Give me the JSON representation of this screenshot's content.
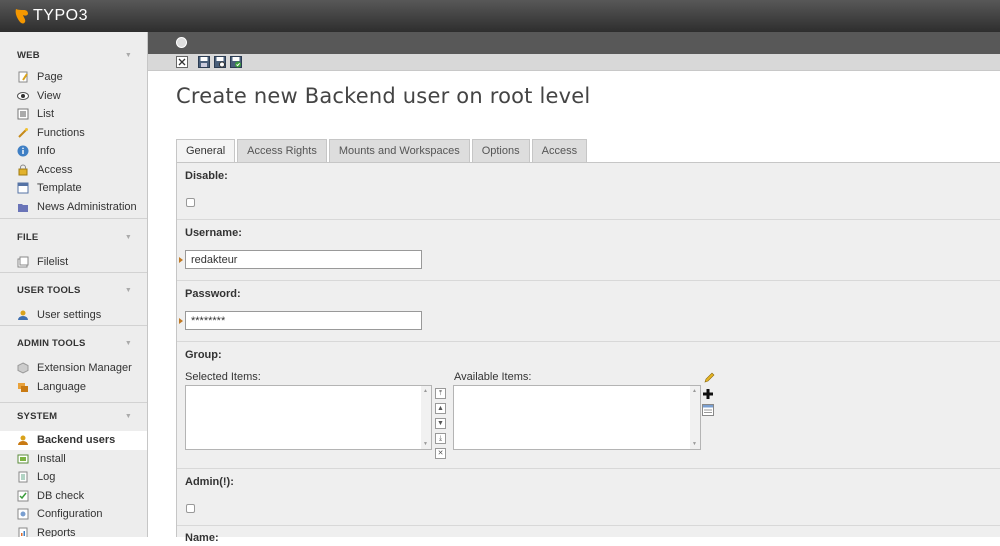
{
  "app": {
    "logo_text": "TYPO3",
    "brand_color": "#f49700"
  },
  "sidebar": {
    "groups": [
      {
        "title": "WEB",
        "items": [
          {
            "label": "Page",
            "icon": "page-icon"
          },
          {
            "label": "View",
            "icon": "eye-icon"
          },
          {
            "label": "List",
            "icon": "list-icon"
          },
          {
            "label": "Functions",
            "icon": "wand-icon"
          },
          {
            "label": "Info",
            "icon": "info-icon"
          },
          {
            "label": "Access",
            "icon": "lock-icon"
          },
          {
            "label": "Template",
            "icon": "template-icon"
          },
          {
            "label": "News Administration",
            "icon": "folder-icon"
          }
        ]
      },
      {
        "title": "FILE",
        "items": [
          {
            "label": "Filelist",
            "icon": "filelist-icon"
          }
        ]
      },
      {
        "title": "USER TOOLS",
        "items": [
          {
            "label": "User settings",
            "icon": "user-icon"
          }
        ]
      },
      {
        "title": "ADMIN TOOLS",
        "items": [
          {
            "label": "Extension Manager",
            "icon": "extension-icon"
          },
          {
            "label": "Language",
            "icon": "language-icon"
          }
        ]
      },
      {
        "title": "SYSTEM",
        "items": [
          {
            "label": "Backend users",
            "icon": "backend-user-icon"
          },
          {
            "label": "Install",
            "icon": "install-icon"
          },
          {
            "label": "Log",
            "icon": "log-icon"
          },
          {
            "label": "DB check",
            "icon": "db-check-icon"
          },
          {
            "label": "Configuration",
            "icon": "configuration-icon"
          },
          {
            "label": "Reports",
            "icon": "reports-icon"
          }
        ]
      }
    ],
    "active_item": "Backend users"
  },
  "page": {
    "title": "Create new Backend user on root level"
  },
  "tabs": [
    "General",
    "Access Rights",
    "Mounts and Workspaces",
    "Options",
    "Access"
  ],
  "active_tab": "General",
  "form": {
    "disable_label": "Disable:",
    "username_label": "Username:",
    "username_value": "redakteur",
    "password_label": "Password:",
    "password_value": "********",
    "group_label": "Group:",
    "selected_items_label": "Selected Items:",
    "available_items_label": "Available Items:",
    "admin_label": "Admin(!):",
    "name_label": "Name:"
  }
}
